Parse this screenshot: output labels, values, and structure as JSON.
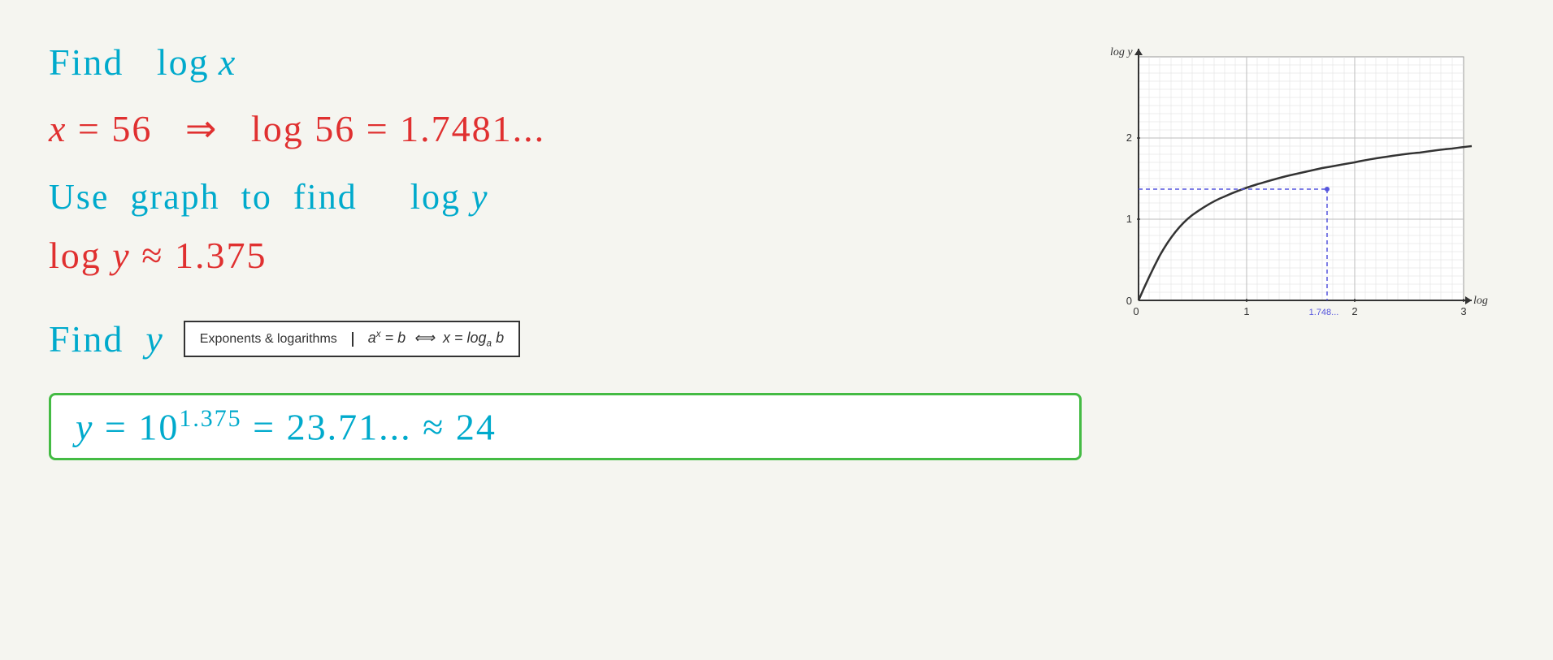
{
  "page": {
    "background": "#f5f5f0"
  },
  "content": {
    "line1": "Find  log x",
    "line2": "x = 56  ⇒  log 56 = 1.7481...",
    "line3": "Use graph to find   log y",
    "line4": "log y ≈ 1.375",
    "find_y_label": "Find  y",
    "exponent_box_label": "Exponents & logarithms",
    "exponent_formula": "aˣ = b  ⟺  x = logₐ b",
    "result": "y = 10¹·³⁷⁵ = 23.71... ≈ 24",
    "graph": {
      "x_label": "log x",
      "y_label": "log y",
      "x_marker": "1.748...",
      "y_marker": "1.375",
      "grid_color": "#cccccc",
      "curve_color": "#333333",
      "dashed_color": "#5555dd"
    }
  }
}
